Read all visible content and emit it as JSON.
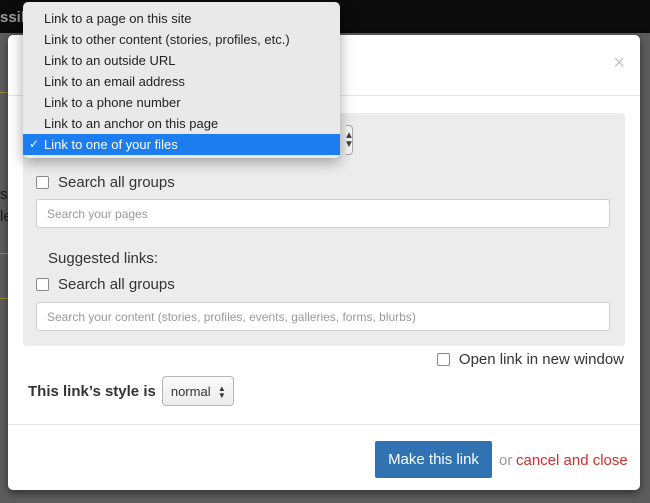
{
  "background_page": {
    "title_fragment": "ssil",
    "left_fragments": [
      "s",
      "le"
    ]
  },
  "link_type_menu": {
    "items": [
      "Link to a page on this site",
      "Link to other content (stories, profiles, etc.)",
      "Link to an outside URL",
      "Link to an email address",
      "Link to a phone number",
      "Link to an anchor on this page",
      "Link to one of your files"
    ],
    "selected_index": 6,
    "check_glyph": "✓"
  },
  "modal": {
    "close_glyph": "×",
    "search_all_groups_1": "Search all groups",
    "pages_search": {
      "placeholder": "Search your pages",
      "value": ""
    },
    "suggested_links_label": "Suggested links:",
    "search_all_groups_2": "Search all groups",
    "content_search": {
      "placeholder": "Search your content (stories, profiles, events, galleries, forms, blurbs)",
      "value": ""
    },
    "open_new_window_label": "Open link in new window",
    "style_label": "This link’s style is",
    "style_value": "normal",
    "make_link_button": "Make this link",
    "or_text": "or",
    "cancel_link": "cancel and close"
  },
  "colors": {
    "primary_button": "#3072b2",
    "cancel_link": "#c9302c",
    "menu_selected": "#1c7df1"
  }
}
